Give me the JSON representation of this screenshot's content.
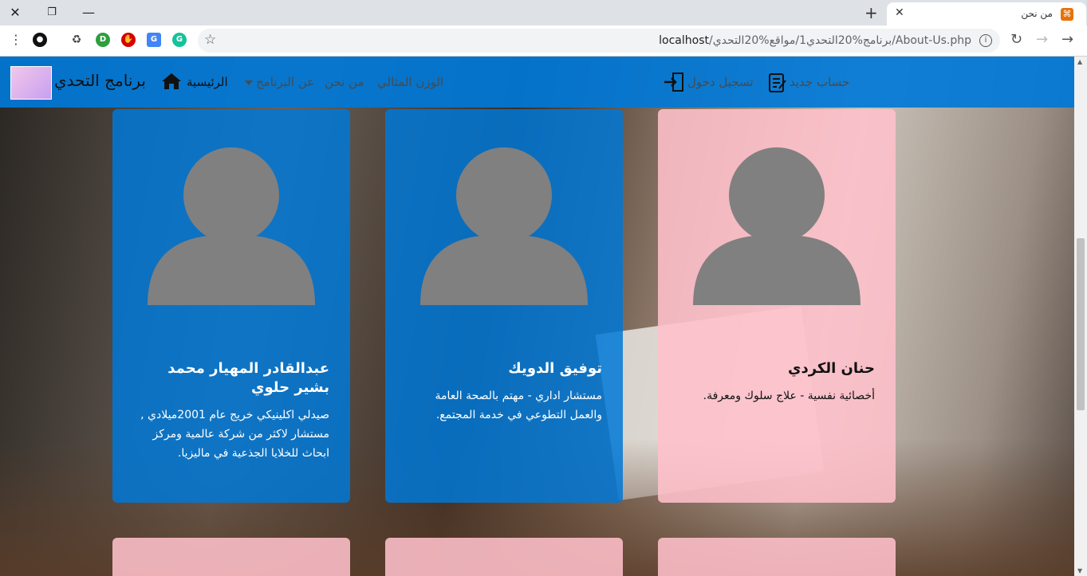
{
  "browser": {
    "tab_title": "من نحن",
    "url_host": "localhost",
    "url_path": "/برنامج%20التحدي1/مواقع%20التحدي/About-Us.php"
  },
  "navbar": {
    "brand": "برنامج التحدي",
    "home": "الرئيسية",
    "about_program": "عن البرنامج",
    "about_us": "من نحن",
    "ideal_weight": "الوزن المثالي",
    "login": "تسجيل دخول",
    "register": "حساب جديد"
  },
  "cards": [
    {
      "name": "حنان الكردي",
      "description": "أخصائية نفسية - علاج سلوك ومعرفة."
    },
    {
      "name": "توفيق الدويك",
      "description": "مستشار اداري - مهتم بالصحة العامة والعمل التطوعي في خدمة المجتمع."
    },
    {
      "name": "عبدالقادر المهيار محمد بشير حلوي",
      "description": "صيدلي اكلينيكي خريج عام 2001ميلادي , مستشار لاكثر من شركة عالمية ومركز ابحاث للخلايا الجذعية في ماليزيا."
    }
  ],
  "colors": {
    "navbar": "#0078d7",
    "card_blue": "#0078d7",
    "card_pink": "#ffc0cb",
    "avatar": "#808080"
  }
}
